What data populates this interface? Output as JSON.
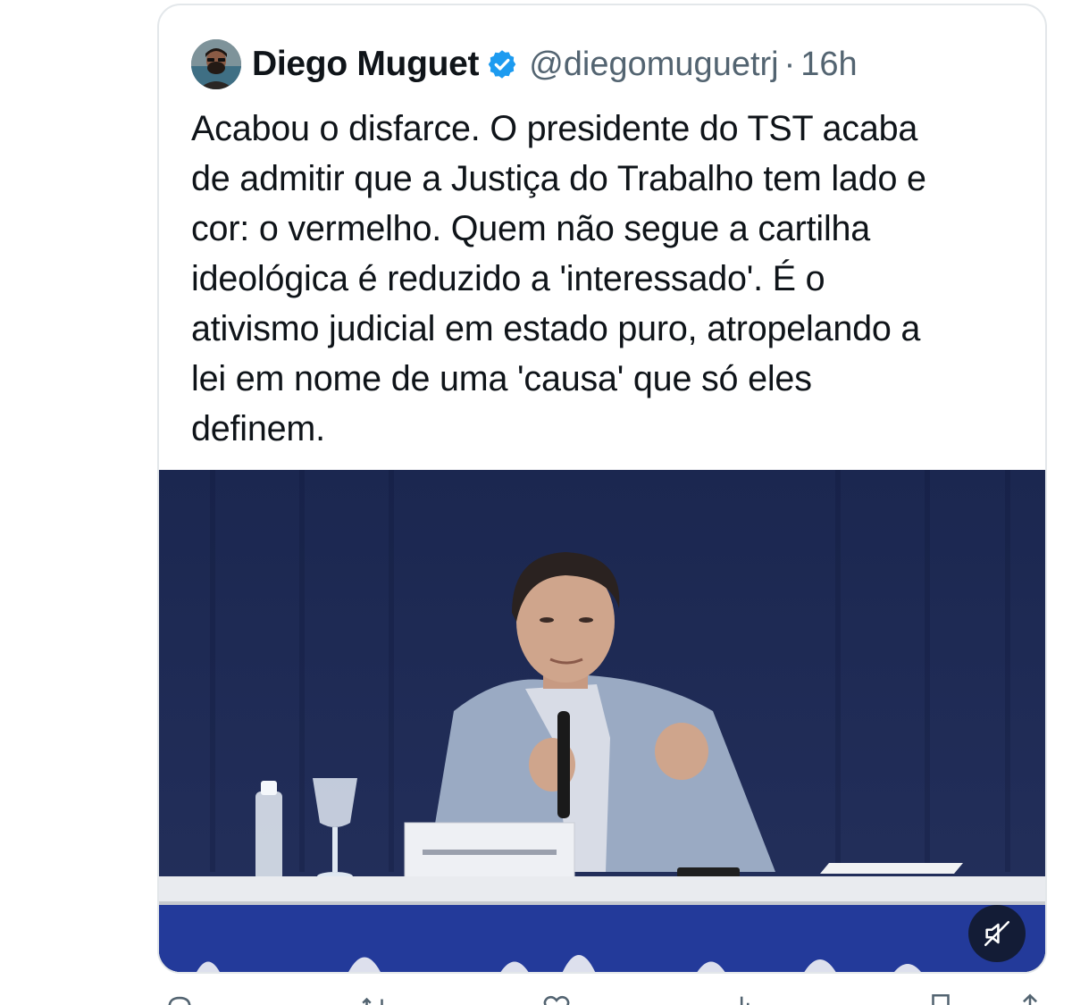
{
  "tweet": {
    "author_name": "Diego Muguet",
    "handle": "@diegomuguetrj",
    "separator": "·",
    "time": "16h",
    "verified_color": "#1d9bf0",
    "text": "Acabou o disfarce. O presidente do TST acaba\nde admitir que a Justiça do Trabalho tem lado e\ncor: o vermelho. Quem não segue a cartilha\nideológica é reduzido a 'interessado'. É o\nativismo judicial em estado puro, atropelando a\nlei em nome de uma 'causa' que só eles\ndefinem."
  },
  "media": {
    "type": "video",
    "mute_icon": "speaker-muted-icon"
  },
  "actions": {
    "icons": [
      "reply-icon",
      "retweet-icon",
      "like-icon",
      "views-icon",
      "bookmark-icon",
      "share-icon"
    ]
  }
}
